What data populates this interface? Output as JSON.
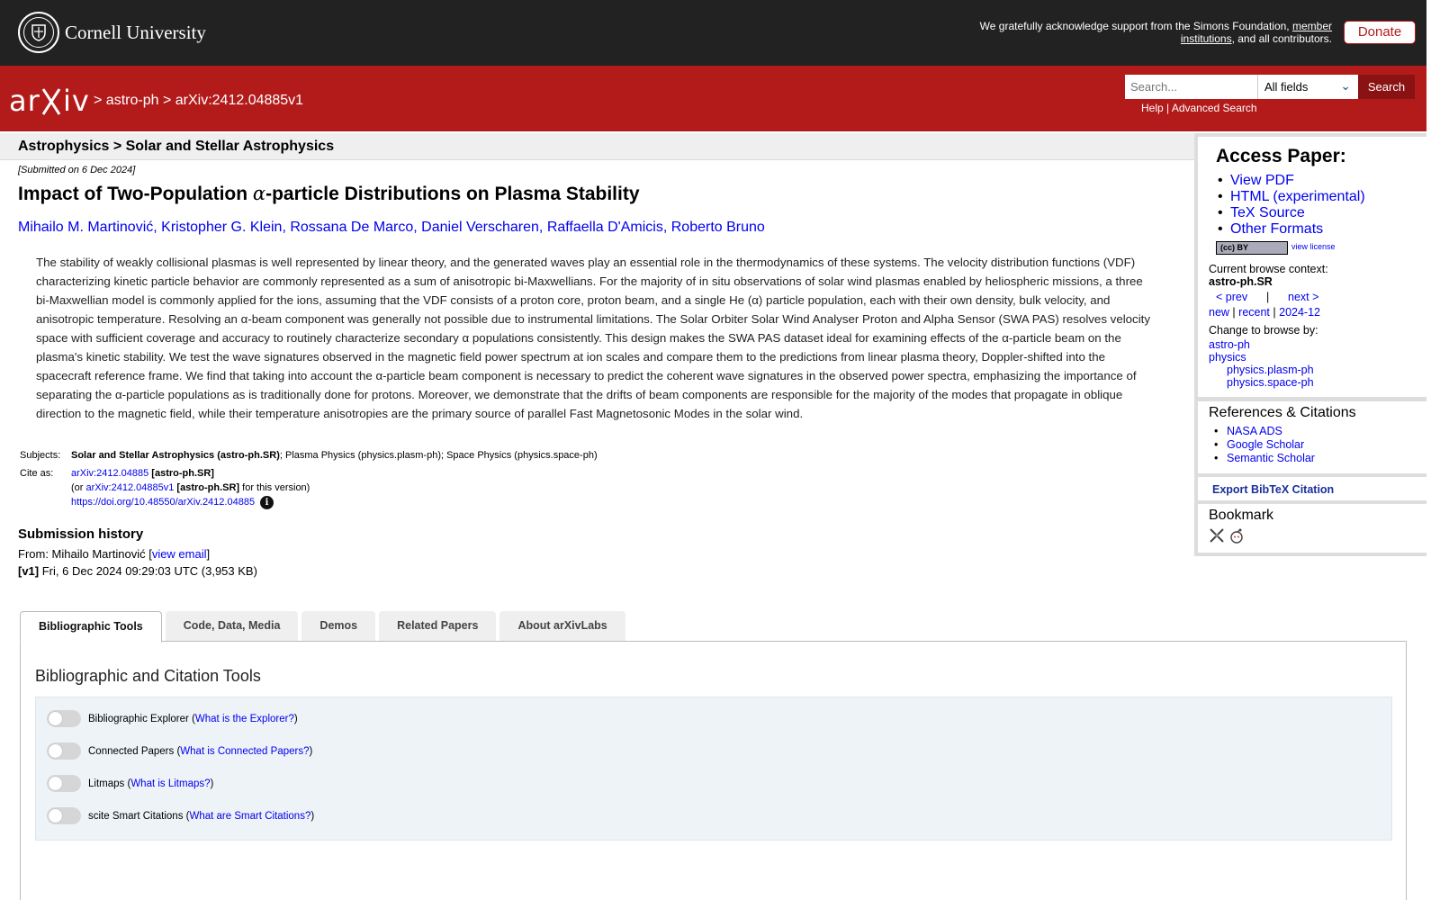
{
  "banner": {
    "org_name": "Cornell University",
    "support_text_1": "We gratefully acknowledge support from the Simons Foundation,",
    "support_link": "member institutions",
    "support_text_2": ", and all contributors.",
    "donate_label": "Donate"
  },
  "header": {
    "logo_text": "arXiv",
    "breadcrumb_sep": ">",
    "breadcrumb_archive": "astro-ph",
    "breadcrumb_id": "arXiv:2412.04885v1",
    "search_placeholder": "Search...",
    "search_field_value": "All fields",
    "search_button": "Search",
    "help_label": "Help",
    "divider": "|",
    "advanced_label": "Advanced Search"
  },
  "subject_header": "Astrophysics > Solar and Stellar Astrophysics",
  "paper": {
    "submitted": "[Submitted on 6 Dec 2024]",
    "title_pre": "Impact of Two-Population ",
    "title_alpha": "α",
    "title_post": "-particle Distributions on Plasma Stability",
    "authors": [
      "Mihailo M. Martinović",
      "Kristopher G. Klein",
      "Rossana De Marco",
      "Daniel Verscharen",
      "Raffaella D'Amicis",
      "Roberto Bruno"
    ],
    "author_sep": ", ",
    "abstract": "The stability of weakly collisional plasmas is well represented by linear theory, and the generated waves play an essential role in the thermodynamics of these systems. The velocity distribution functions (VDF) characterizing kinetic particle behavior are commonly represented as a sum of anisotropic bi-Maxwellians. For the majority of in situ observations of solar wind plasmas enabled by heliospheric missions, a three bi-Maxwellian model is commonly applied for the ions, assuming that the VDF consists of a proton core, proton beam, and a single He (α) particle population, each with their own density, bulk velocity, and anisotropic temperature. Resolving an α-beam component was generally not possible due to instrumental limitations. The Solar Orbiter Solar Wind Analyser Proton and Alpha Sensor (SWA PAS) resolves velocity space with sufficient coverage and accuracy to routinely characterize secondary α populations consistently. This design makes the SWA PAS dataset ideal for examining effects of the α-particle beam on the plasma's kinetic stability. We test the wave signatures observed in the magnetic field power spectrum at ion scales and compare them to the predictions from linear plasma theory, Doppler-shifted into the spacecraft reference frame. We find that taking into account the α-particle beam component is necessary to predict the coherent wave signatures in the observed power spectra, emphasizing the importance of separating the α-particle populations as is traditionally done for protons. Moreover, we demonstrate that the drifts of beam components are responsible for the majority of the modes that propagate in oblique direction to the magnetic field, while their temperature anisotropies are the primary source of parallel Fast Magnetosonic Modes in the solar wind."
  },
  "meta": {
    "subjects_label": "Subjects:",
    "subjects_primary": "Solar and Stellar Astrophysics (astro-ph.SR)",
    "subjects_rest": "; Plasma Physics (physics.plasm-ph); Space Physics (physics.space-ph)",
    "cite_label": "Cite as:",
    "cite_id": "arXiv:2412.04885",
    "cite_tag": "[astro-ph.SR]",
    "or_pre": "(or ",
    "or_id": "arXiv:2412.04885v1",
    "or_tag": "[astro-ph.SR]",
    "or_post": " for this version)",
    "doi": "https://doi.org/10.48550/arXiv.2412.04885",
    "info_glyph": "i"
  },
  "history": {
    "title": "Submission history",
    "from_pre": "From: Mihailo Martinović [",
    "from_link": "view email",
    "from_post": "]",
    "v1_tag": "[v1]",
    "v1_text": " Fri, 6 Dec 2024 09:29:03 UTC (3,953 KB)"
  },
  "tabs": [
    "Bibliographic Tools",
    "Code, Data, Media",
    "Demos",
    "Related Papers",
    "About arXivLabs"
  ],
  "tools": {
    "title": "Bibliographic and Citation Tools",
    "items": [
      {
        "name": "Bibliographic Explorer",
        "link": "What is the Explorer?"
      },
      {
        "name": "Connected Papers",
        "link": "What is Connected Papers?"
      },
      {
        "name": "Litmaps",
        "link": "What is Litmaps?"
      },
      {
        "name": "scite Smart Citations",
        "link": "What are Smart Citations?"
      }
    ]
  },
  "sidebar": {
    "access_title": "Access Paper:",
    "access_links": [
      "View PDF",
      "HTML (experimental)",
      "TeX Source",
      "Other Formats"
    ],
    "license_badge": "(cc) BY",
    "view_license": "view license",
    "context_label": "Current browse context:",
    "context_value": "astro-ph.SR",
    "prev": "< prev",
    "bar": "|",
    "next": "next >",
    "new": "new",
    "recent": "recent",
    "month": "2024-12",
    "change_label": "Change to browse by:",
    "browse_links": [
      "astro-ph",
      "physics",
      "physics.plasm-ph",
      "physics.space-ph"
    ],
    "refs_title": "References & Citations",
    "refs_links": [
      "NASA ADS",
      "Google Scholar",
      "Semantic Scholar"
    ],
    "export_label": "Export BibTeX Citation",
    "bookmark_title": "Bookmark"
  }
}
